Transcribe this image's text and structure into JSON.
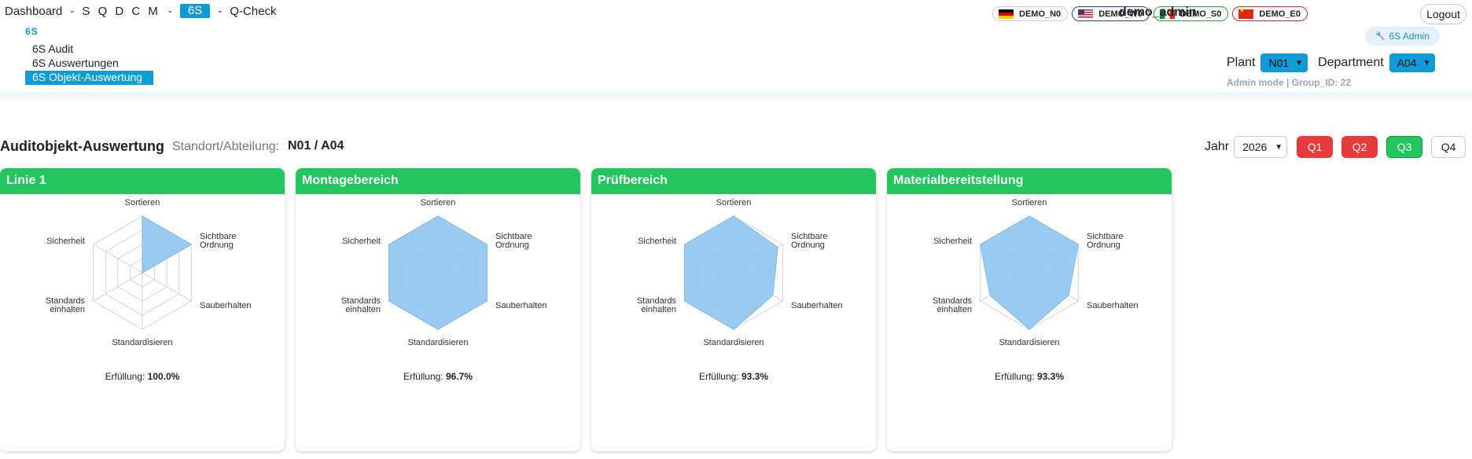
{
  "topnav": {
    "items": [
      {
        "label": "Dashboard",
        "active": false
      },
      {
        "label": "S Q D C M",
        "active": false
      },
      {
        "label": "6S",
        "active": true
      },
      {
        "label": "Q-Check",
        "active": false
      }
    ],
    "separator": "-"
  },
  "subnav": {
    "title": "6S",
    "items": [
      {
        "label": "6S Audit",
        "active": false
      },
      {
        "label": "6S Auswertungen",
        "active": false
      },
      {
        "label": "6S Objekt-Auswertung",
        "active": true
      }
    ]
  },
  "header": {
    "languages": [
      {
        "label": "DEMO_N0",
        "flag": "germany-flag-icon",
        "border": "#cccccc"
      },
      {
        "label": "DEMO_W0",
        "flag": "usa-flag-icon",
        "border": "#2a3f9e"
      },
      {
        "label": "DEMO_S0",
        "flag": "italy-flag-icon",
        "border": "#2e9a3a"
      },
      {
        "label": "DEMO_E0",
        "flag": "china-flag-icon",
        "border": "#d22b2b"
      }
    ],
    "username": "demo_admin",
    "logout_label": "Logout",
    "admin_label": "6S Admin",
    "plant_label": "Plant",
    "plant_value": "N01",
    "department_label": "Department",
    "department_value": "A04",
    "admin_mode": "Admin mode | Group_ID: 22"
  },
  "main": {
    "title": "Auditobjekt-Auswertung",
    "location_label": "Standort/Abteilung:",
    "location_value": "N01 / A04",
    "year_label": "Jahr",
    "year_value": "2026",
    "quarters": [
      {
        "label": "Q1",
        "state": "red"
      },
      {
        "label": "Q2",
        "state": "red"
      },
      {
        "label": "Q3",
        "state": "green"
      },
      {
        "label": "Q4",
        "state": "white"
      }
    ]
  },
  "chart_data": [
    {
      "type": "radar",
      "title": "Linie 1",
      "axes": [
        "Sortieren",
        "Sichtbare Ordnung",
        "Sauberhalten",
        "Standardisieren",
        "Standards einhalten",
        "Sicherheit"
      ],
      "values": [
        1,
        1,
        0,
        0,
        0,
        0
      ],
      "range": [
        0,
        1
      ],
      "rings": 4,
      "fulfillment_label": "Erfüllung:",
      "fulfillment_value": "100.0%"
    },
    {
      "type": "radar",
      "title": "Montagebereich",
      "axes": [
        "Sortieren",
        "Sichtbare Ordnung",
        "Sauberhalten",
        "Standardisieren",
        "Standards einhalten",
        "Sicherheit"
      ],
      "values": [
        1,
        1,
        1,
        1,
        1,
        1
      ],
      "range": [
        0,
        1
      ],
      "rings": 4,
      "fulfillment_label": "Erfüllung:",
      "fulfillment_value": "96.7%"
    },
    {
      "type": "radar",
      "title": "Prüfbereich",
      "axes": [
        "Sortieren",
        "Sichtbare Ordnung",
        "Sauberhalten",
        "Standardisieren",
        "Standards einhalten",
        "Sicherheit"
      ],
      "values": [
        1,
        0.9,
        0.8,
        1,
        1,
        1
      ],
      "range": [
        0,
        1
      ],
      "rings": 4,
      "fulfillment_label": "Erfüllung:",
      "fulfillment_value": "93.3%"
    },
    {
      "type": "radar",
      "title": "Materialbereitstellung",
      "axes": [
        "Sortieren",
        "Sichtbare Ordnung",
        "Sauberhalten",
        "Standardisieren",
        "Standards einhalten",
        "Sicherheit"
      ],
      "values": [
        1,
        1,
        0.8,
        1,
        0.8,
        1
      ],
      "range": [
        0,
        1
      ],
      "rings": 4,
      "fulfillment_label": "Erfüllung:",
      "fulfillment_value": "93.3%"
    }
  ],
  "colors": {
    "brand": "#0e9bd6",
    "card_header": "#22c55e",
    "radar_fill": "#8ec5ee",
    "quarter_red": "#e83a3a",
    "quarter_green": "#22c55e"
  }
}
